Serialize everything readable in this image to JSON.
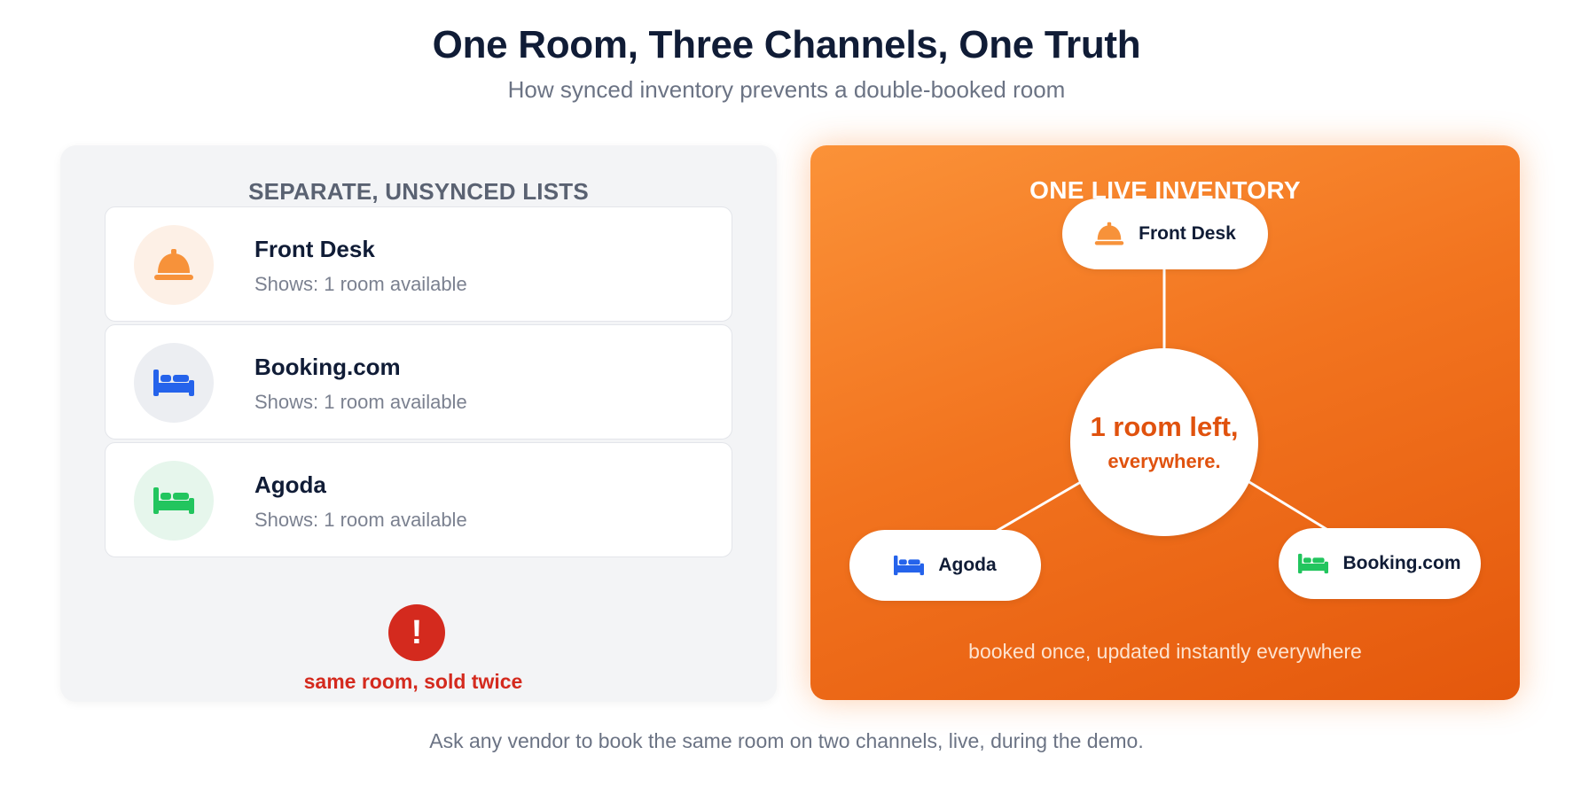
{
  "title": "One Room, Three Channels, One Truth",
  "subtitle": "How synced inventory prevents a double-booked room",
  "left_panel": {
    "heading": "SEPARATE, UNSYNCED LISTS",
    "cards": [
      {
        "name": "Front Desk",
        "status": "Shows: 1 room available",
        "icon": "service-bell-icon",
        "icon_color": "#f7923a",
        "circle_color": "#fdf0e6"
      },
      {
        "name": "Booking.com",
        "status": "Shows: 1 room available",
        "icon": "bed-icon",
        "icon_color": "#2563eb",
        "circle_color": "#eceef2"
      },
      {
        "name": "Agoda",
        "status": "Shows: 1 room available",
        "icon": "bed-icon",
        "icon_color": "#22c55e",
        "circle_color": "#e6f6ec"
      }
    ],
    "alert_symbol": "!",
    "alert_text": "same room, sold twice",
    "alert_color": "#d42a1e"
  },
  "right_panel": {
    "heading": "ONE LIVE INVENTORY",
    "hub_main": "1 room left,",
    "hub_sub": "everywhere.",
    "nodes": {
      "front_desk": {
        "label": "Front Desk",
        "icon": "service-bell-icon",
        "icon_color": "#f7923a"
      },
      "agoda": {
        "label": "Agoda",
        "icon": "bed-icon",
        "icon_color": "#2563eb"
      },
      "booking": {
        "label": "Booking.com",
        "icon": "bed-icon",
        "icon_color": "#22c55e"
      }
    },
    "caption": "booked once, updated instantly everywhere",
    "accent_color": "#f2741f"
  },
  "footer": "Ask any vendor to book the same room on two channels, live, during the demo."
}
